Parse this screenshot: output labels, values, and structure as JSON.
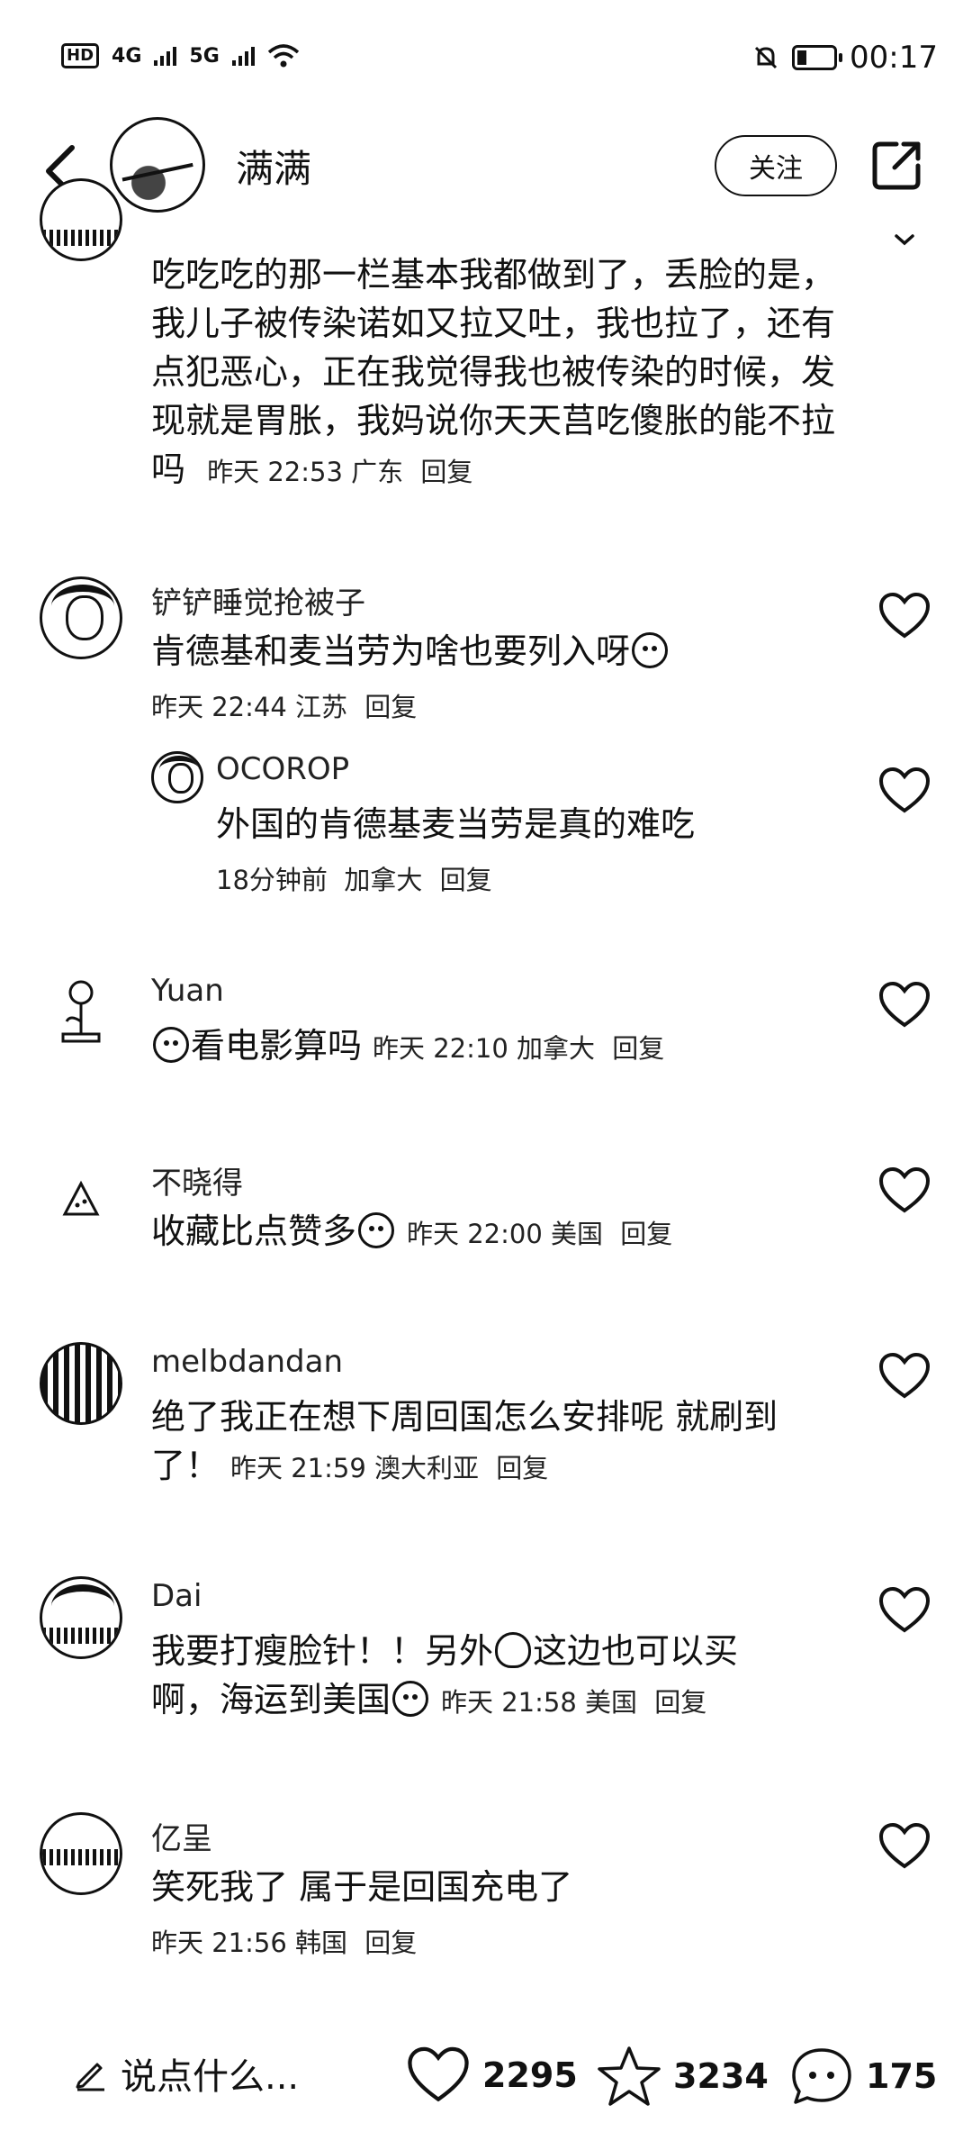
{
  "status_bar": {
    "hd": "HD",
    "net1": "4G",
    "net2": "5G",
    "time": "00:17"
  },
  "header": {
    "title": "满满",
    "follow_label": "关注"
  },
  "comments": [
    {
      "author": "",
      "text": "吃吃吃的那一栏基本我都做到了，丢脸的是，我儿子被传染诺如又拉又吐，我也拉了，还有点犯恶心，正在我觉得我也被传染的时候，发现就是胃胀，我妈说你天天莒吃傻胀的能不拉吗",
      "time": "昨天 22:53",
      "location": "广东",
      "reply_label": "回复"
    },
    {
      "author": "铲铲睡觉抢被子",
      "text": "肯德基和麦当劳为啥也要列入呀",
      "time": "昨天 22:44",
      "location": "江苏",
      "reply_label": "回复",
      "reply": {
        "author": "OCOROP",
        "text": "外国的肯德基麦当劳是真的难吃",
        "time": "18分钟前",
        "location": "加拿大",
        "reply_label": "回复"
      }
    },
    {
      "author": "Yuan",
      "text": "看电影算吗",
      "time": "昨天 22:10",
      "location": "加拿大",
      "reply_label": "回复"
    },
    {
      "author": "不晓得",
      "text": "收藏比点赞多",
      "time": "昨天 22:00",
      "location": "美国",
      "reply_label": "回复"
    },
    {
      "author": "melbdandan",
      "text_line1": "绝了我正在想下周回国怎么安排呢 就刷到",
      "text_line2": "了！",
      "time": "昨天 21:59",
      "location": "澳大利亚",
      "reply_label": "回复"
    },
    {
      "author": "Dai",
      "text_part1": "我要打瘦脸针！！另外",
      "text_part2": "这边也可以买",
      "text_line2": "啊，海运到美国",
      "time": "昨天 21:58",
      "location": "美国",
      "reply_label": "回复"
    },
    {
      "author": "亿呈",
      "text": "笑死我了 属于是回国充电了",
      "time": "昨天 21:56",
      "location": "韩国",
      "reply_label": "回复"
    }
  ],
  "bottom_bar": {
    "input_placeholder": "说点什么...",
    "likes": "2295",
    "favorites": "3234",
    "comments": "175"
  }
}
